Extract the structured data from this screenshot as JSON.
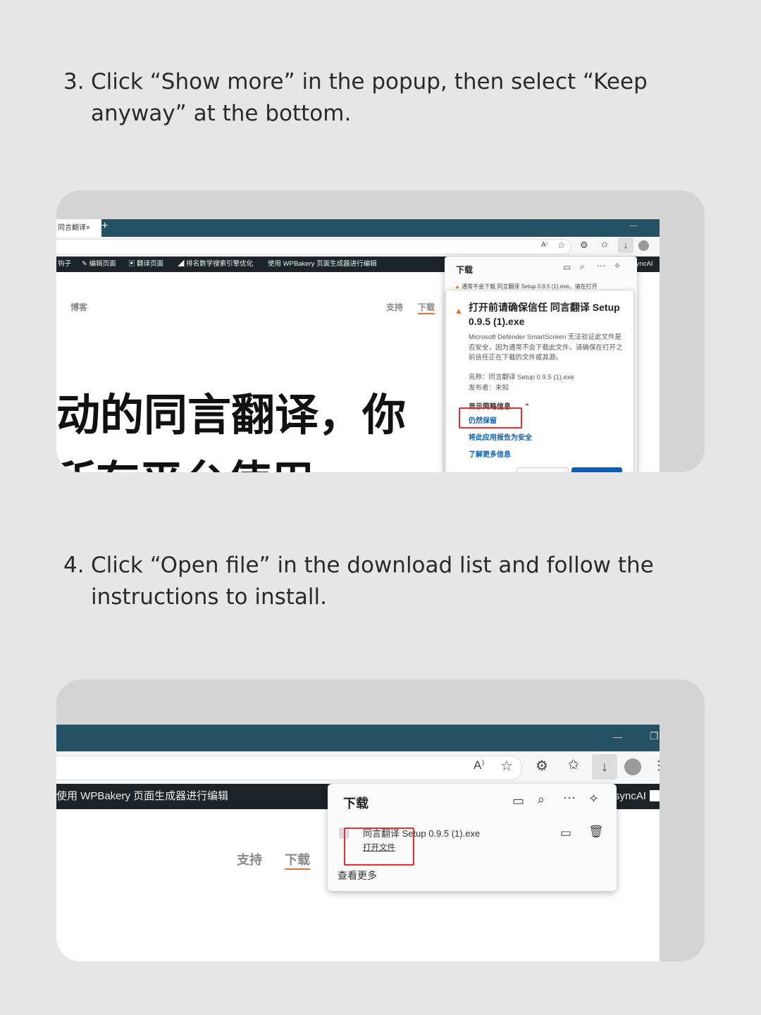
{
  "steps": {
    "s3": {
      "number": "3.",
      "text": "Click “Show more” in the popup, then select “Keep anyway” at the bottom."
    },
    "s4": {
      "number": "4.",
      "text": "Click “Open file” in the download list and follow the instructions to install."
    }
  },
  "shot1": {
    "tab_title": "同言翻译",
    "tab_close": "×",
    "new_tab": "+",
    "minimize": "—",
    "adminbar": [
      "钩子",
      "编辑页面",
      "翻译页面",
      "排名数学搜索引擎优化",
      "使用 WPBakery 页面生成器进行编辑"
    ],
    "adminbar_right": "syncAI",
    "site_nav_left": "博客",
    "site_nav": [
      "支持",
      "下载"
    ],
    "hero_line1": "动的同言翻译，你",
    "hero_line2": "所有平台使用",
    "panel_title": "下载",
    "panel_notice": "通常不会下载 同言翻译 Setup 0.9.5 (1).exe。请在打开",
    "dialog_title": "打开前请确保信任 同言翻译 Setup 0.9.5 (1).exe",
    "dialog_body": "Microsoft Defender SmartScreen 无法验证此文件是否安全，因为通常不会下载此文件。请确保在打开之前信任正在下载的文件或其源。",
    "name_row": "名称：同言翻译 Setup 0.9.5 (1).exe",
    "publisher_row": "发布者：未知",
    "show_less": "显示简略信息",
    "keep_anyway": "仍然保留",
    "report_safe": "将此应用报告为安全",
    "learn_more": "了解更多信息"
  },
  "shot2": {
    "minimize": "—",
    "adminbar_item": "使用 WPBakery 页面生成器进行编辑",
    "adminbar_right": "syncAI",
    "site_nav": [
      "支持",
      "下载"
    ],
    "panel_title": "下载",
    "file_name": "同言翻译 Setup 0.9.5 (1).exe",
    "open_file": "打开文件",
    "see_more": "查看更多"
  },
  "colors": {
    "titlebar": "#245264",
    "accent": "#e8702a",
    "highlight": "#e03030",
    "link": "#0a5fb8"
  }
}
